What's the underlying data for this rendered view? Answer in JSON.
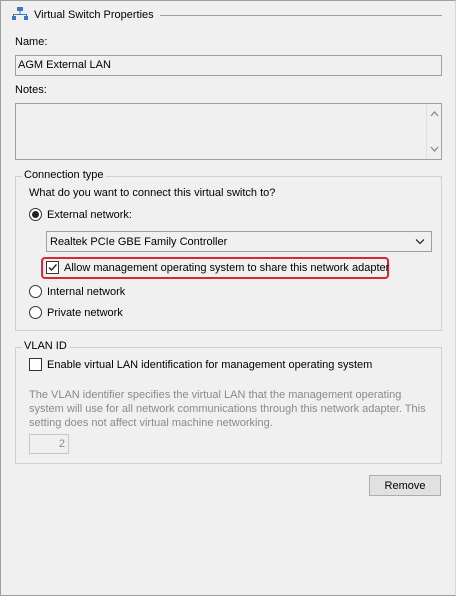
{
  "section": {
    "title": "Virtual Switch Properties",
    "icon": "network-switch-icon"
  },
  "name": {
    "label": "Name:",
    "value": "AGM External LAN"
  },
  "notes": {
    "label": "Notes:",
    "value": ""
  },
  "connection": {
    "group_label": "Connection type",
    "question": "What do you want to connect this virtual switch to?",
    "external_label": "External network:",
    "external_selected": true,
    "adapter_value": "Realtek PCIe GBE Family Controller",
    "allow_mgmt_label": "Allow management operating system to share this network adapter",
    "allow_mgmt_checked": true,
    "internal_label": "Internal network",
    "private_label": "Private network"
  },
  "vlan": {
    "group_label": "VLAN ID",
    "enable_label": "Enable virtual LAN identification for management operating system",
    "enable_checked": false,
    "description": "The VLAN identifier specifies the virtual LAN that the management operating system will use for all network communications through this network adapter. This setting does not affect virtual machine networking.",
    "id_value": "2"
  },
  "remove_label": "Remove",
  "colors": {
    "highlight": "#d9282f",
    "background": "#f0f0f0"
  }
}
